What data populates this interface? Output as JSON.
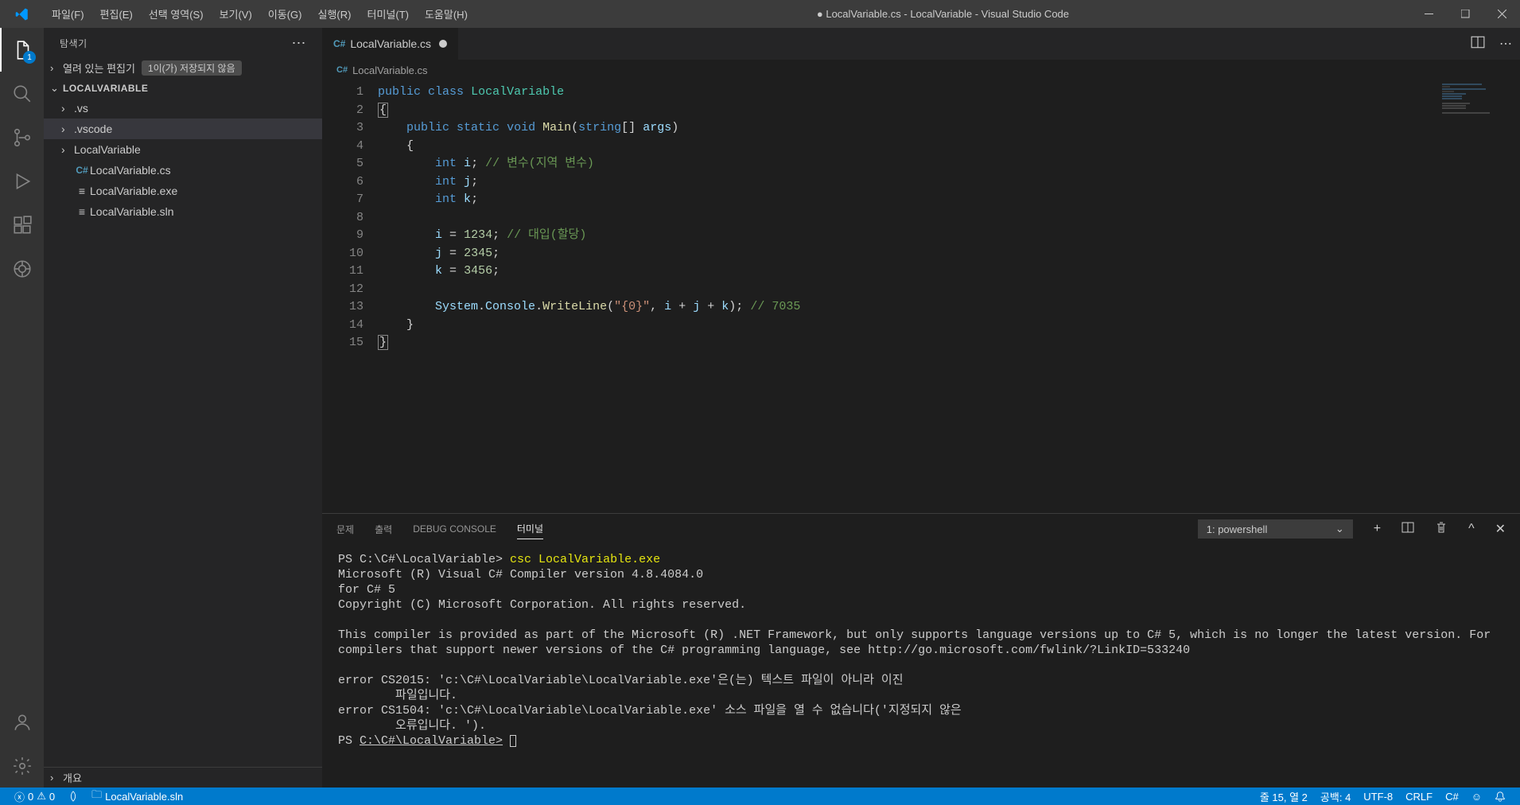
{
  "title": "● LocalVariable.cs - LocalVariable - Visual Studio Code",
  "menu": [
    "파일(F)",
    "편집(E)",
    "선택 영역(S)",
    "보기(V)",
    "이동(G)",
    "실행(R)",
    "터미널(T)",
    "도움말(H)"
  ],
  "activity_badge": "1",
  "sidebar": {
    "title": "탐색기",
    "open_editors": "열려 있는 편집기",
    "unsaved_badge": "1이(가) 저장되지 않음",
    "project": "LOCALVARIABLE",
    "items": [
      {
        "label": ".vs",
        "type": "folder"
      },
      {
        "label": ".vscode",
        "type": "folder"
      },
      {
        "label": "LocalVariable",
        "type": "folder"
      },
      {
        "label": "LocalVariable.cs",
        "type": "cs"
      },
      {
        "label": "LocalVariable.exe",
        "type": "file"
      },
      {
        "label": "LocalVariable.sln",
        "type": "file"
      }
    ],
    "outline": "개요"
  },
  "tab": {
    "label": "LocalVariable.cs"
  },
  "breadcrumb": "LocalVariable.cs",
  "code_lines": 15,
  "panel": {
    "tabs": [
      "문제",
      "출력",
      "DEBUG CONSOLE",
      "터미널"
    ],
    "active": 3,
    "dropdown": "1: powershell"
  },
  "terminal": {
    "prompt1": "PS C:\\C#\\LocalVariable> ",
    "cmd1": "csc LocalVariable.exe",
    "out1": "Microsoft (R) Visual C# Compiler version 4.8.4084.0",
    "out2": "for C# 5",
    "out3": "Copyright (C) Microsoft Corporation. All rights reserved.",
    "out4": "This compiler is provided as part of the Microsoft (R) .NET Framework, but only supports language versions up to C# 5, which is no longer the latest version. For compilers that support newer versions of the C# programming language, see http://go.microsoft.com/fwlink/?LinkID=533240",
    "err1": "error CS2015: 'c:\\C#\\LocalVariable\\LocalVariable.exe'은(는) 텍스트 파일이 아니라 이진\n        파일입니다.",
    "err2": "error CS1504: 'c:\\C#\\LocalVariable\\LocalVariable.exe' 소스 파일을 열 수 없습니다('지정되지 않은\n        오류입니다. ').",
    "prompt2_pre": "PS ",
    "prompt2_path": "C:\\C#\\LocalVariable>"
  },
  "status": {
    "errors": "0",
    "warnings": "0",
    "sln": "LocalVariable.sln",
    "line_col": "줄 15, 열 2",
    "spaces": "공백: 4",
    "encoding": "UTF-8",
    "eol": "CRLF",
    "lang": "C#"
  }
}
